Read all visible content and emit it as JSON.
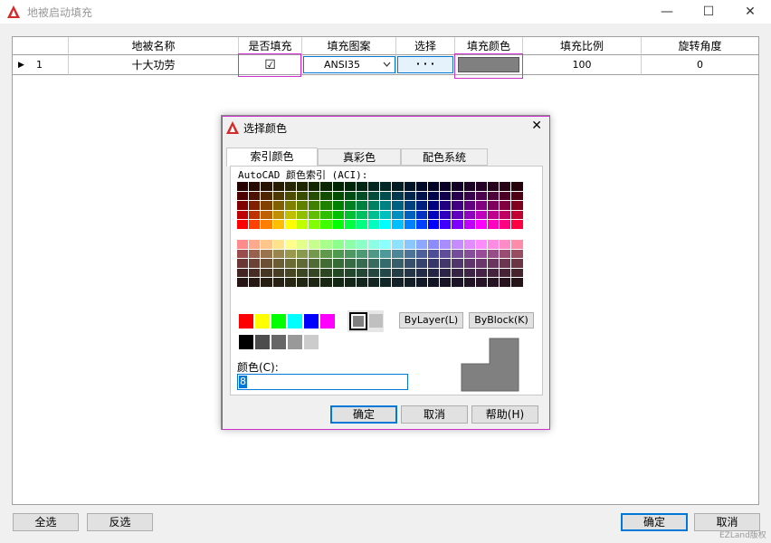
{
  "window": {
    "title": "地被启动填充",
    "minimize": "—",
    "maximize": "☐",
    "close": "✕"
  },
  "table": {
    "columns": [
      "",
      "地被名称",
      "是否填充",
      "填充图案",
      "选择",
      "填充颜色",
      "填充比例",
      "旋转角度"
    ],
    "rows": [
      {
        "indicator": "▶",
        "index": "1",
        "name": "十大功劳",
        "fill_checked": "☑",
        "pattern": "ANSI35",
        "select": "· · ·",
        "fill_color": "#808080",
        "scale": "100",
        "rotation": "0"
      }
    ]
  },
  "dialog": {
    "title": "选择颜色",
    "close": "✕",
    "tabs": [
      "索引颜色",
      "真彩色",
      "配色系统"
    ],
    "aci_label": "AutoCAD 颜色索引 (ACI):",
    "bylayer": "ByLayer(L)",
    "byblock": "ByBlock(K)",
    "color_label": "颜色(C):",
    "color_value": "8",
    "ok": "确定",
    "cancel": "取消",
    "help": "帮助(H)",
    "preview_color": "#808080",
    "standard_colors": [
      "#ff0000",
      "#ffff00",
      "#00ff00",
      "#00ffff",
      "#0000ff",
      "#ff00ff"
    ],
    "gray_colors": [
      "#808080",
      "#c0c0c0"
    ],
    "gray_ramp": [
      "#000000",
      "#4d4d4d",
      "#666666",
      "#999999",
      "#cccccc",
      "#ffffff"
    ]
  },
  "footer": {
    "select_all": "全选",
    "invert": "反选",
    "ok": "确定",
    "cancel": "取消"
  },
  "watermark": "EZLand版权"
}
